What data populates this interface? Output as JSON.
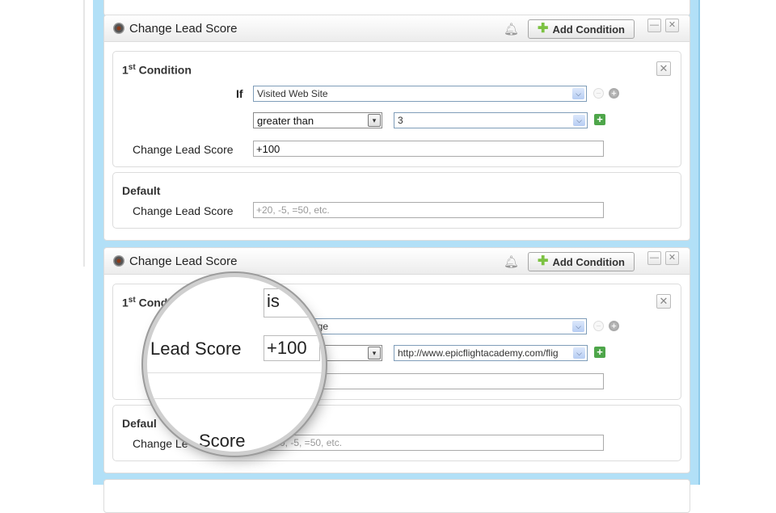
{
  "cards": [
    {
      "title": "Change Lead Score",
      "add_condition_label": "Add Condition",
      "condition": {
        "title_num": "1",
        "title_sup": "st",
        "title_rest": "Condition",
        "if_label": "If",
        "trigger_select": "Visited Web Site",
        "operator_select": "greater than",
        "value_select": "3",
        "change_label": "Change Lead Score",
        "change_value": "+100"
      },
      "default": {
        "title": "Default",
        "change_label": "Change Lead Score",
        "change_placeholder": "+20, -5, =50, etc."
      }
    },
    {
      "title": "Change Lead Score",
      "add_condition_label": "Add Condition",
      "condition": {
        "title_num": "1",
        "title_sup": "st",
        "title_rest": "Condition",
        "title_visible": "Con",
        "trigger_select_visible": "Page",
        "value_select": "http://www.epicflightacademy.com/flig",
        "change_label_visible": "Ch"
      },
      "default": {
        "title_visible": "Defaul",
        "change_label_visible": "Change Le",
        "change_placeholder_visible": "0, -5, =50, etc."
      }
    }
  ],
  "magnifier": {
    "is_text": "is",
    "lead_score_label": "Lead Score",
    "lead_score_value": "+100",
    "score_text": "Score"
  },
  "icons": {
    "close": "✕",
    "minimize": "—",
    "bell": "🔔",
    "plus": "+",
    "minus": "−",
    "dropdown": "▼"
  }
}
